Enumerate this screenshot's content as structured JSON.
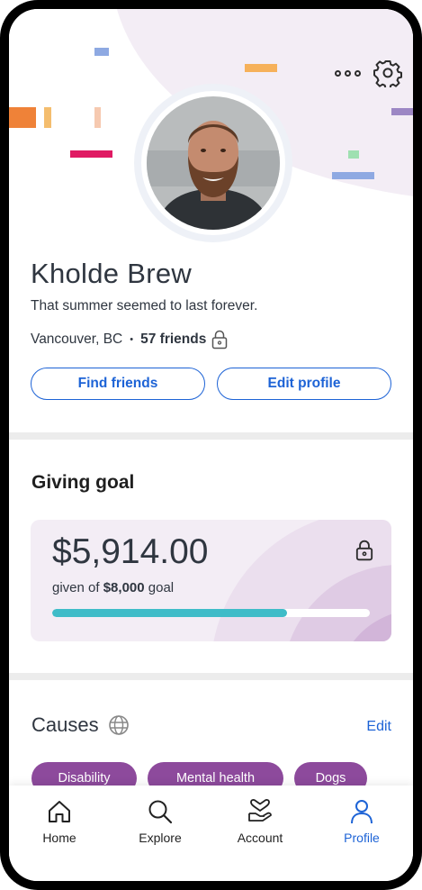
{
  "profile": {
    "name": "Kholde Brew",
    "bio": "That summer seemed to last forever.",
    "location": "Vancouver, BC",
    "separator": "•",
    "friends": "57 friends"
  },
  "actions": {
    "find_friends": "Find friends",
    "edit_profile": "Edit profile"
  },
  "giving_goal": {
    "title": "Giving goal",
    "amount": "$5,914.00",
    "given_prefix": "given of ",
    "goal": "$8,000",
    "goal_suffix": " goal",
    "progress_fraction": 0.74
  },
  "causes": {
    "title": "Causes",
    "edit": "Edit",
    "chips": [
      "Disability",
      "Mental health",
      "Dogs"
    ]
  },
  "nav": {
    "items": [
      {
        "label": "Home",
        "icon": "home-icon"
      },
      {
        "label": "Explore",
        "icon": "search-icon"
      },
      {
        "label": "Account",
        "icon": "heart-hand-icon"
      },
      {
        "label": "Profile",
        "icon": "person-icon",
        "active": true
      }
    ]
  },
  "colors": {
    "accent": "#1d63d6",
    "chip": "#8d4a9c",
    "progress": "#3fbcc8",
    "card_bg": "#f3edf5"
  }
}
